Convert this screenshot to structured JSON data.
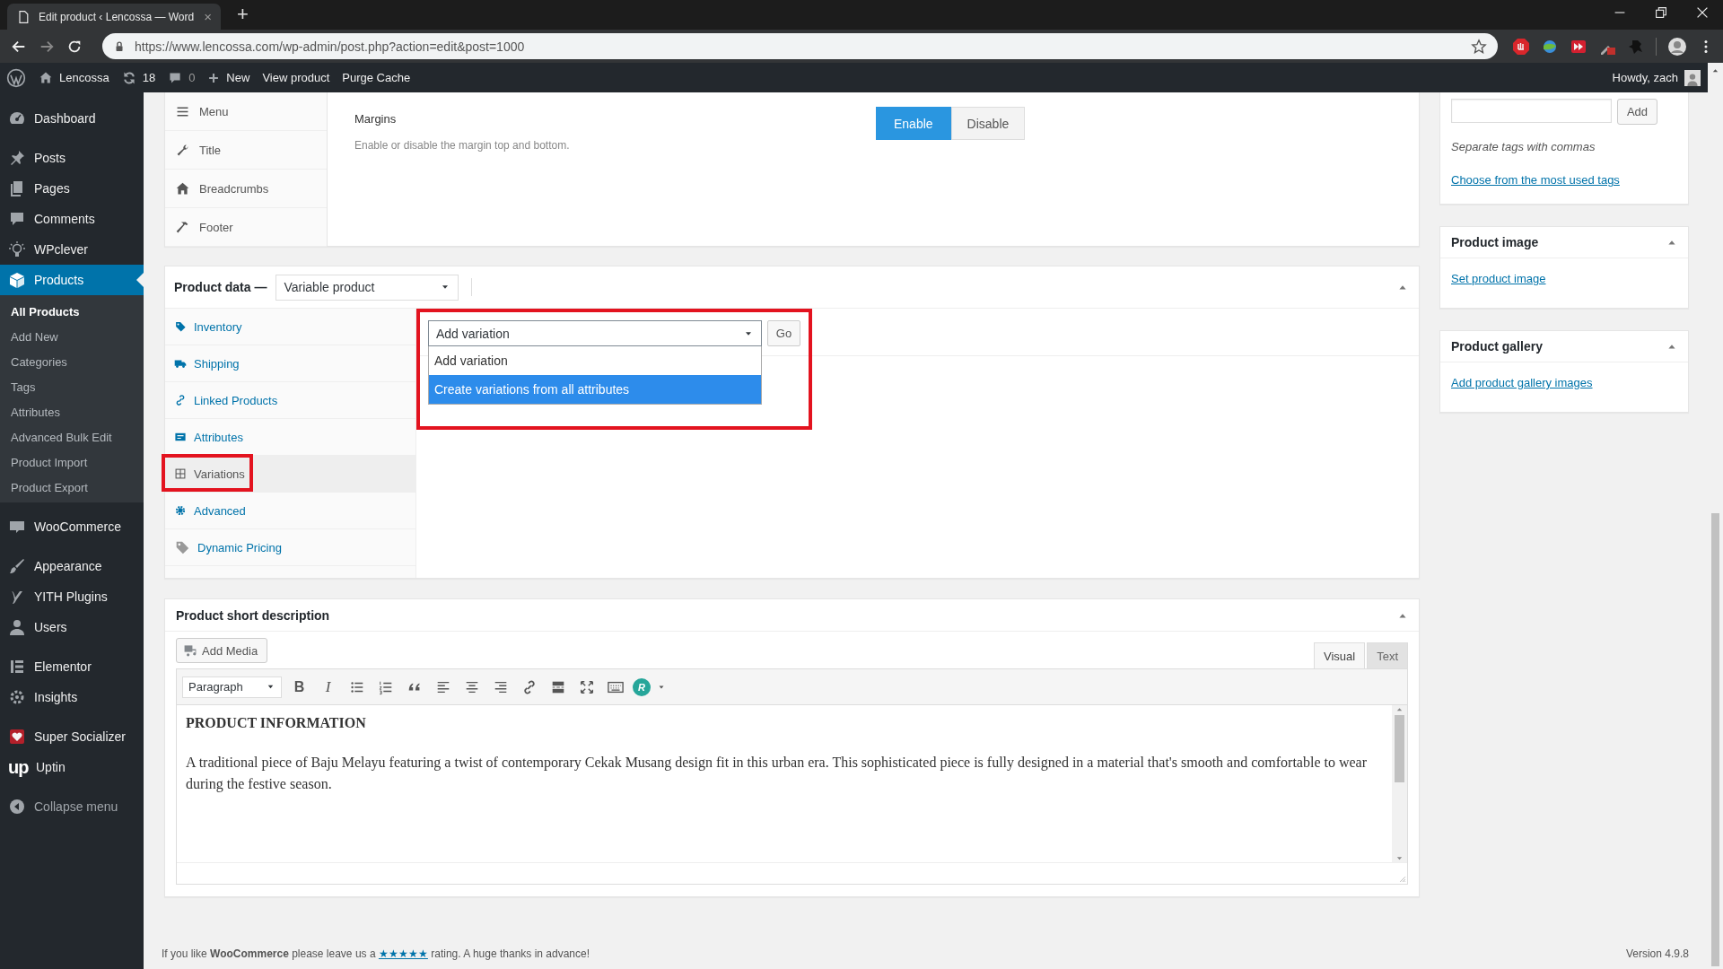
{
  "browser": {
    "tab_title": "Edit product ‹ Lencossa — Word",
    "tab_close": "×",
    "new_tab": "+",
    "url": "https://www.lencossa.com/wp-admin/post.php?action=edit&post=1000"
  },
  "admin_bar": {
    "site": "Lencossa",
    "updates": "18",
    "comments": "0",
    "new": "New",
    "links": [
      "View product",
      "Purge Cache"
    ],
    "greeting": "Howdy, zach"
  },
  "sidebar": {
    "groups": [
      [
        {
          "label": "Dashboard",
          "selected": false
        }
      ],
      [
        {
          "label": "Posts",
          "selected": false
        },
        {
          "label": "Pages",
          "selected": false
        },
        {
          "label": "Comments",
          "selected": false
        },
        {
          "label": "WPclever",
          "selected": false
        },
        {
          "label": "Products",
          "selected": true,
          "submenu": [
            {
              "label": "All Products",
              "selected": true
            },
            {
              "label": "Add New",
              "selected": false
            },
            {
              "label": "Categories",
              "selected": false
            },
            {
              "label": "Tags",
              "selected": false
            },
            {
              "label": "Attributes",
              "selected": false
            },
            {
              "label": "Advanced Bulk Edit",
              "selected": false
            },
            {
              "label": "Product Import",
              "selected": false
            },
            {
              "label": "Product Export",
              "selected": false
            }
          ]
        }
      ],
      [
        {
          "label": "WooCommerce",
          "selected": false
        }
      ],
      [
        {
          "label": "Appearance",
          "selected": false
        },
        {
          "label": "YITH Plugins",
          "selected": false
        },
        {
          "label": "Users",
          "selected": false
        }
      ],
      [
        {
          "label": "Elementor",
          "selected": false
        },
        {
          "label": "Insights",
          "selected": false
        }
      ],
      [
        {
          "label": "Super Socializer",
          "selected": false
        },
        {
          "label": "Uptin",
          "selected": false,
          "logo_text": "up"
        }
      ]
    ],
    "collapse": "Collapse menu"
  },
  "theme_options": {
    "nav": [
      "Menu",
      "Title",
      "Breadcrumbs",
      "Footer"
    ],
    "setting": {
      "label": "Margins",
      "description": "Enable or disable the margin top and bottom.",
      "options": [
        {
          "label": "Enable",
          "selected": true
        },
        {
          "label": "Disable",
          "selected": false
        }
      ]
    }
  },
  "product_data": {
    "title": "Product data —",
    "type_select": "Variable product",
    "tabs": [
      {
        "label": "Inventory",
        "selected": false,
        "annotated": false
      },
      {
        "label": "Shipping",
        "selected": false,
        "annotated": false
      },
      {
        "label": "Linked Products",
        "selected": false,
        "annotated": false
      },
      {
        "label": "Attributes",
        "selected": false,
        "annotated": false
      },
      {
        "label": "Variations",
        "selected": true,
        "annotated": true
      },
      {
        "label": "Advanced",
        "selected": false,
        "annotated": false
      },
      {
        "label": "Dynamic Pricing",
        "selected": false,
        "annotated": false
      }
    ],
    "variation_select": {
      "value": "Add variation",
      "annotated": true,
      "options": [
        {
          "label": "Add variation",
          "highlighted": false
        },
        {
          "label": "Create variations from all attributes",
          "highlighted": true
        }
      ]
    },
    "go_button": "Go"
  },
  "short_description": {
    "title": "Product short description",
    "add_media": "Add Media",
    "editor_tabs": [
      {
        "label": "Visual",
        "selected": true
      },
      {
        "label": "Text",
        "selected": false
      }
    ],
    "toolbar": {
      "format": "Paragraph",
      "bold": "B",
      "italic": "I",
      "plugin": "R"
    },
    "heading": "PRODUCT INFORMATION",
    "paragraph": "A traditional piece of Baju Melayu featuring a twist of contemporary Cekak Musang design fit in this urban era. This sophisticated piece is fully designed in a material that's smooth and comfortable to wear during the festive season."
  },
  "tags_box": {
    "add_button": "Add",
    "hint": "Separate tags with commas",
    "link": "Choose from the most used tags"
  },
  "product_image": {
    "title": "Product image",
    "link": "Set product image"
  },
  "product_gallery": {
    "title": "Product gallery",
    "link": "Add product gallery images"
  },
  "footer": {
    "before": "If you like **WooCommerce** please leave us a",
    "link": "★★★★★",
    "after": "rating. A huge thanks in advance!",
    "version": "Version 4.9.8"
  }
}
